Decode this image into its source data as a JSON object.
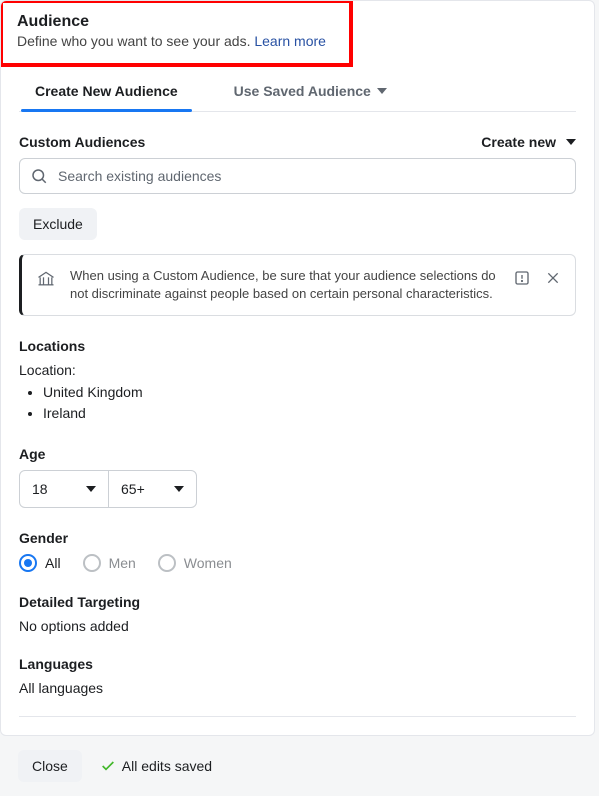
{
  "header": {
    "title": "Audience",
    "subtitle": "Define who you want to see your ads. ",
    "learn_more": "Learn more"
  },
  "tabs": {
    "create": "Create New Audience",
    "saved": "Use Saved Audience"
  },
  "custom_audiences": {
    "label": "Custom Audiences",
    "create_new": "Create new",
    "search_placeholder": "Search existing audiences",
    "exclude": "Exclude",
    "notice": "When using a Custom Audience, be sure that your audience selections do not discriminate against people based on certain personal characteristics."
  },
  "locations": {
    "label": "Locations",
    "sublabel": "Location:",
    "items": [
      "United Kingdom",
      "Ireland"
    ]
  },
  "age": {
    "label": "Age",
    "min": "18",
    "max": "65+"
  },
  "gender": {
    "label": "Gender",
    "options": {
      "all": "All",
      "men": "Men",
      "women": "Women"
    },
    "selected": "all"
  },
  "detailed": {
    "label": "Detailed Targeting",
    "value": "No options added"
  },
  "languages": {
    "label": "Languages",
    "value": "All languages"
  },
  "footer": {
    "close": "Close",
    "saved": "All edits saved"
  }
}
